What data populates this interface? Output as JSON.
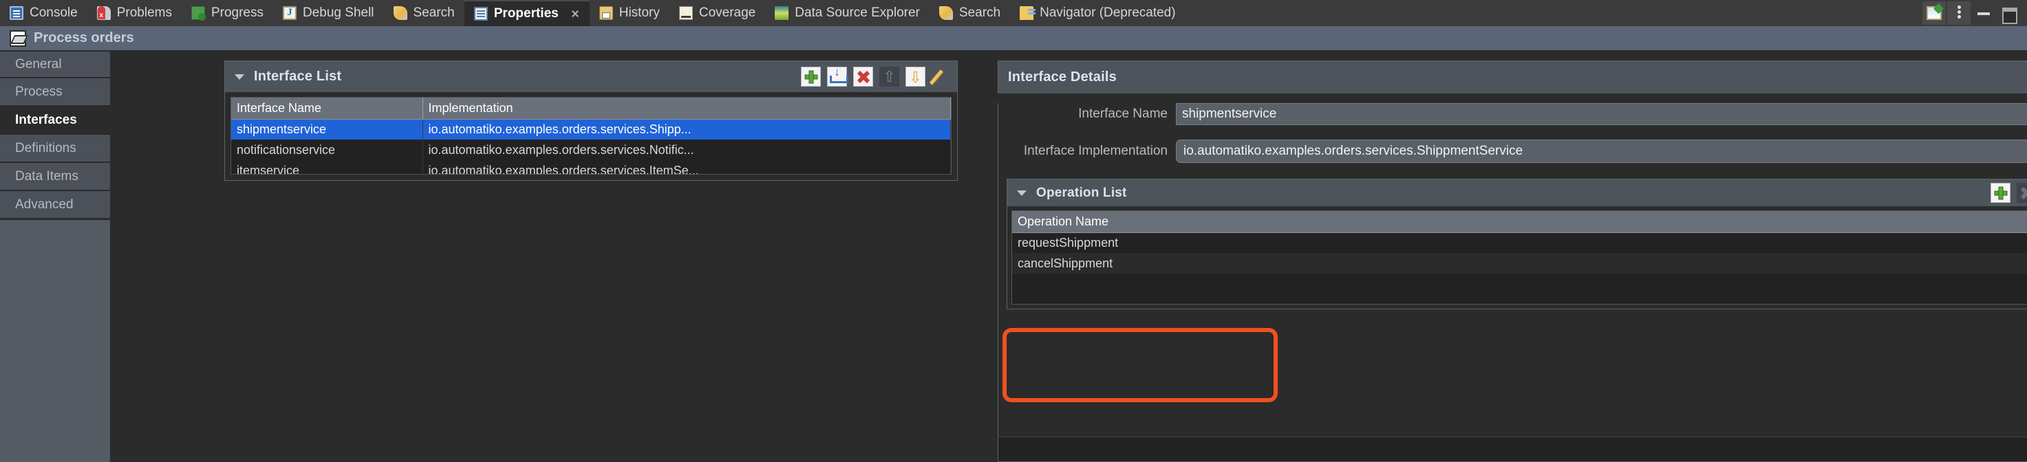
{
  "window": {
    "view_title": "Process orders",
    "view_icon": "process-diagram-icon"
  },
  "tabbar": {
    "tabs": [
      {
        "label": "Console",
        "icon": "console-icon",
        "active": false,
        "closable": false
      },
      {
        "label": "Problems",
        "icon": "problems-icon",
        "active": false,
        "closable": false
      },
      {
        "label": "Progress",
        "icon": "progress-icon",
        "active": false,
        "closable": false
      },
      {
        "label": "Debug Shell",
        "icon": "debug-shell-icon",
        "active": false,
        "closable": false
      },
      {
        "label": "Search",
        "icon": "search-icon",
        "active": false,
        "closable": false
      },
      {
        "label": "Properties",
        "icon": "properties-icon",
        "active": true,
        "closable": true
      },
      {
        "label": "History",
        "icon": "history-icon",
        "active": false,
        "closable": false
      },
      {
        "label": "Coverage",
        "icon": "coverage-icon",
        "active": false,
        "closable": false
      },
      {
        "label": "Data Source Explorer",
        "icon": "data-source-explorer-icon",
        "active": false,
        "closable": false
      },
      {
        "label": "Search",
        "icon": "search-icon",
        "active": false,
        "closable": false
      },
      {
        "label": "Navigator (Deprecated)",
        "icon": "navigator-icon",
        "active": false,
        "closable": false
      }
    ],
    "right_buttons": [
      {
        "name": "pin-view-button",
        "icon": "pin-icon"
      },
      {
        "name": "view-menu-button",
        "icon": "vertical-dots-icon"
      },
      {
        "name": "minimize-button",
        "icon": "minimize-icon"
      },
      {
        "name": "maximize-button",
        "icon": "maximize-icon"
      }
    ]
  },
  "sidebar": {
    "items": [
      {
        "label": "General",
        "active": false
      },
      {
        "label": "Process",
        "active": false
      },
      {
        "label": "Interfaces",
        "active": true
      },
      {
        "label": "Definitions",
        "active": false
      },
      {
        "label": "Data Items",
        "active": false
      },
      {
        "label": "Advanced",
        "active": false
      }
    ]
  },
  "interface_list": {
    "title": "Interface List",
    "tools": [
      {
        "name": "add-interface-button",
        "icon": "plus-icon",
        "enabled": true
      },
      {
        "name": "import-interface-button",
        "icon": "import-icon",
        "enabled": true
      },
      {
        "name": "delete-interface-button",
        "icon": "red-x-icon",
        "enabled": true
      },
      {
        "name": "move-up-button",
        "icon": "arrow-up-icon",
        "enabled": false
      },
      {
        "name": "move-down-button",
        "icon": "arrow-down-icon",
        "enabled": true
      },
      {
        "name": "edit-interface-button",
        "icon": "pencil-icon",
        "enabled": true
      }
    ],
    "columns": [
      "Interface Name",
      "Implementation"
    ],
    "rows": [
      {
        "name": "shipmentservice",
        "implementation": "io.automatiko.examples.orders.services.Shipp...",
        "selected": true
      },
      {
        "name": "notificationservice",
        "implementation": "io.automatiko.examples.orders.services.Notific...",
        "selected": false
      },
      {
        "name": "itemservice",
        "implementation": "io.automatiko.examples.orders.services.ItemSe...",
        "selected": false
      }
    ]
  },
  "interface_details": {
    "title": "Interface Details",
    "close_icon": "close-x-icon",
    "fields": {
      "interface_name_label": "Interface Name",
      "interface_name_value": "shipmentservice",
      "interface_implementation_label": "Interface Implementation",
      "interface_implementation_value": "io.automatiko.examples.orders.services.ShippmentService",
      "implementation_add_icon": "plus-icon",
      "implementation_spinner_icon": "up-down-spinner-icon"
    },
    "operation_list": {
      "title": "Operation List",
      "tools": [
        {
          "name": "add-operation-button",
          "icon": "plus-icon",
          "enabled": true
        },
        {
          "name": "delete-operation-button",
          "icon": "grey-x-icon",
          "enabled": false
        },
        {
          "name": "operation-move-up-button",
          "icon": "arrow-up-icon",
          "enabled": false
        },
        {
          "name": "operation-move-down-button",
          "icon": "arrow-down-icon",
          "enabled": false
        },
        {
          "name": "edit-operation-button",
          "icon": "pencil-icon",
          "enabled": false
        }
      ],
      "columns": [
        "Operation Name"
      ],
      "rows": [
        {
          "name": "requestShippment"
        },
        {
          "name": "cancelShippment"
        }
      ]
    }
  },
  "annotation": {
    "name": "operation-list-highlight",
    "color": "#f2501e"
  }
}
